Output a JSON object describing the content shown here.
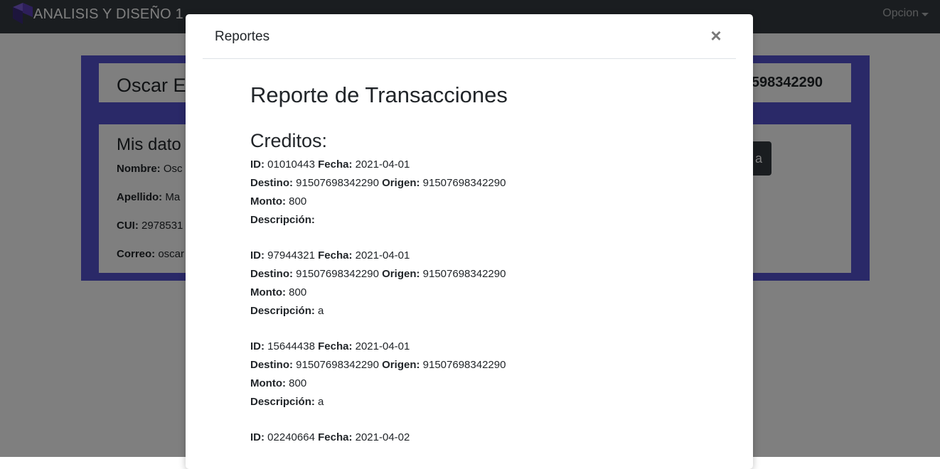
{
  "navbar": {
    "brand": "ANALISIS Y DISEÑO 1",
    "option_label": "Opcion",
    "colors": {
      "background": "#343a40",
      "logo_accent": "#5b3fb5"
    }
  },
  "page": {
    "user_name": "Oscar E",
    "account_fragment": "598342290",
    "data_heading": "Mis dato",
    "fields": [
      {
        "label": "Nombre:",
        "value": "Osc"
      },
      {
        "label": "Apellido:",
        "value": "Ma"
      },
      {
        "label": "CUI:",
        "value": "2978531"
      },
      {
        "label": "Correo:",
        "value": "oscar"
      }
    ],
    "dark_button_label": "a",
    "colors": {
      "frame": "#5552d1"
    }
  },
  "modal": {
    "title": "Reportes",
    "close_label": "×",
    "report_title": "Reporte de Transacciones",
    "section_title": "Creditos:",
    "labels": {
      "id": "ID:",
      "fecha": "Fecha:",
      "destino": "Destino:",
      "origen": "Origen:",
      "monto": "Monto:",
      "descripcion": "Descripción:"
    },
    "transactions": [
      {
        "id": "01010443",
        "fecha": "2021-04-01",
        "destino": "91507698342290",
        "origen": "91507698342290",
        "monto": "800",
        "descripcion": ""
      },
      {
        "id": "97944321",
        "fecha": "2021-04-01",
        "destino": "91507698342290",
        "origen": "91507698342290",
        "monto": "800",
        "descripcion": "a"
      },
      {
        "id": "15644438",
        "fecha": "2021-04-01",
        "destino": "91507698342290",
        "origen": "91507698342290",
        "monto": "800",
        "descripcion": "a"
      },
      {
        "id": "02240664",
        "fecha": "2021-04-02"
      }
    ]
  }
}
